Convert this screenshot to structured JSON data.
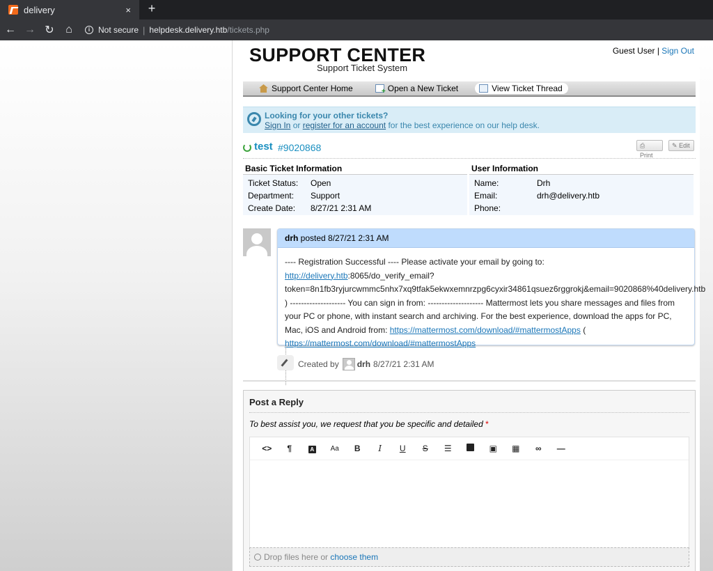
{
  "browser": {
    "tab_title": "delivery",
    "tab_close": "×",
    "new_tab": "+",
    "security": "Not secure",
    "url_host": "helpdesk.delivery.htb",
    "url_path": "/tickets.php"
  },
  "header": {
    "logo_title": "SUPPORT CENTER",
    "logo_subtitle": "Support Ticket System",
    "guest_user": "Guest User",
    "separator": " | ",
    "sign_out": "Sign Out"
  },
  "nav": {
    "home": "Support Center Home",
    "new_ticket": "Open a New Ticket",
    "view_thread": "View Ticket Thread"
  },
  "notice": {
    "title": "Looking for your other tickets?",
    "sign_in": "Sign In",
    "or": " or ",
    "register": "register for an account",
    "rest": " for the best experience on our help desk."
  },
  "ticket": {
    "subject": "test",
    "number": "#9020868",
    "print_label": "Print",
    "edit_label": "Edit"
  },
  "basic_info": {
    "heading": "Basic Ticket Information",
    "rows": [
      {
        "label": "Ticket Status:",
        "value": "Open"
      },
      {
        "label": "Department:",
        "value": "Support"
      },
      {
        "label": "Create Date:",
        "value": "8/27/21 2:31 AM"
      }
    ]
  },
  "user_info": {
    "heading": "User Information",
    "rows": [
      {
        "label": "Name:",
        "value": "Drh"
      },
      {
        "label": "Email:",
        "value": "drh@delivery.htb"
      },
      {
        "label": "Phone:",
        "value": ""
      }
    ]
  },
  "thread": {
    "author": "drh",
    "posted": " posted 8/27/21 2:31 AM",
    "body_1": "---- Registration Successful ---- Please activate your email by going to: ",
    "link_1": "http://delivery.htb",
    "body_2": ":8065/do_verify_email?token=8n1fb3ryjurcwmmc5nhx7xq9tfak5ekwxemnrzpg6cyxir34861qsuez6rggrokj&email=9020868%40delivery.htb ) -------------------- You can sign in from: -------------------- Mattermost lets you share messages and files from your PC or phone, with instant search and archiving. For the best experience, download the apps for PC, Mac, iOS and Android from: ",
    "link_2": "https://mattermost.com/download/#mattermostApps",
    "body_3": " ( ",
    "link_3": "https://mattermost.com/download/#mattermostApps"
  },
  "event": {
    "created_by": "Created by",
    "user": "drh",
    "time": "8/27/21 2:31 AM"
  },
  "reply": {
    "title": "Post a Reply",
    "hint": "To best assist you, we request that you be specific and detailed",
    "required_mark": "*",
    "drop_text": "Drop files here or ",
    "choose": "choose them"
  },
  "toolbar": {
    "code": "<>",
    "paragraph": "¶",
    "font_color": "A",
    "font_size": "Aa",
    "bold": "B",
    "italic": "I",
    "underline": "U",
    "strike": "S",
    "hr": "—"
  }
}
